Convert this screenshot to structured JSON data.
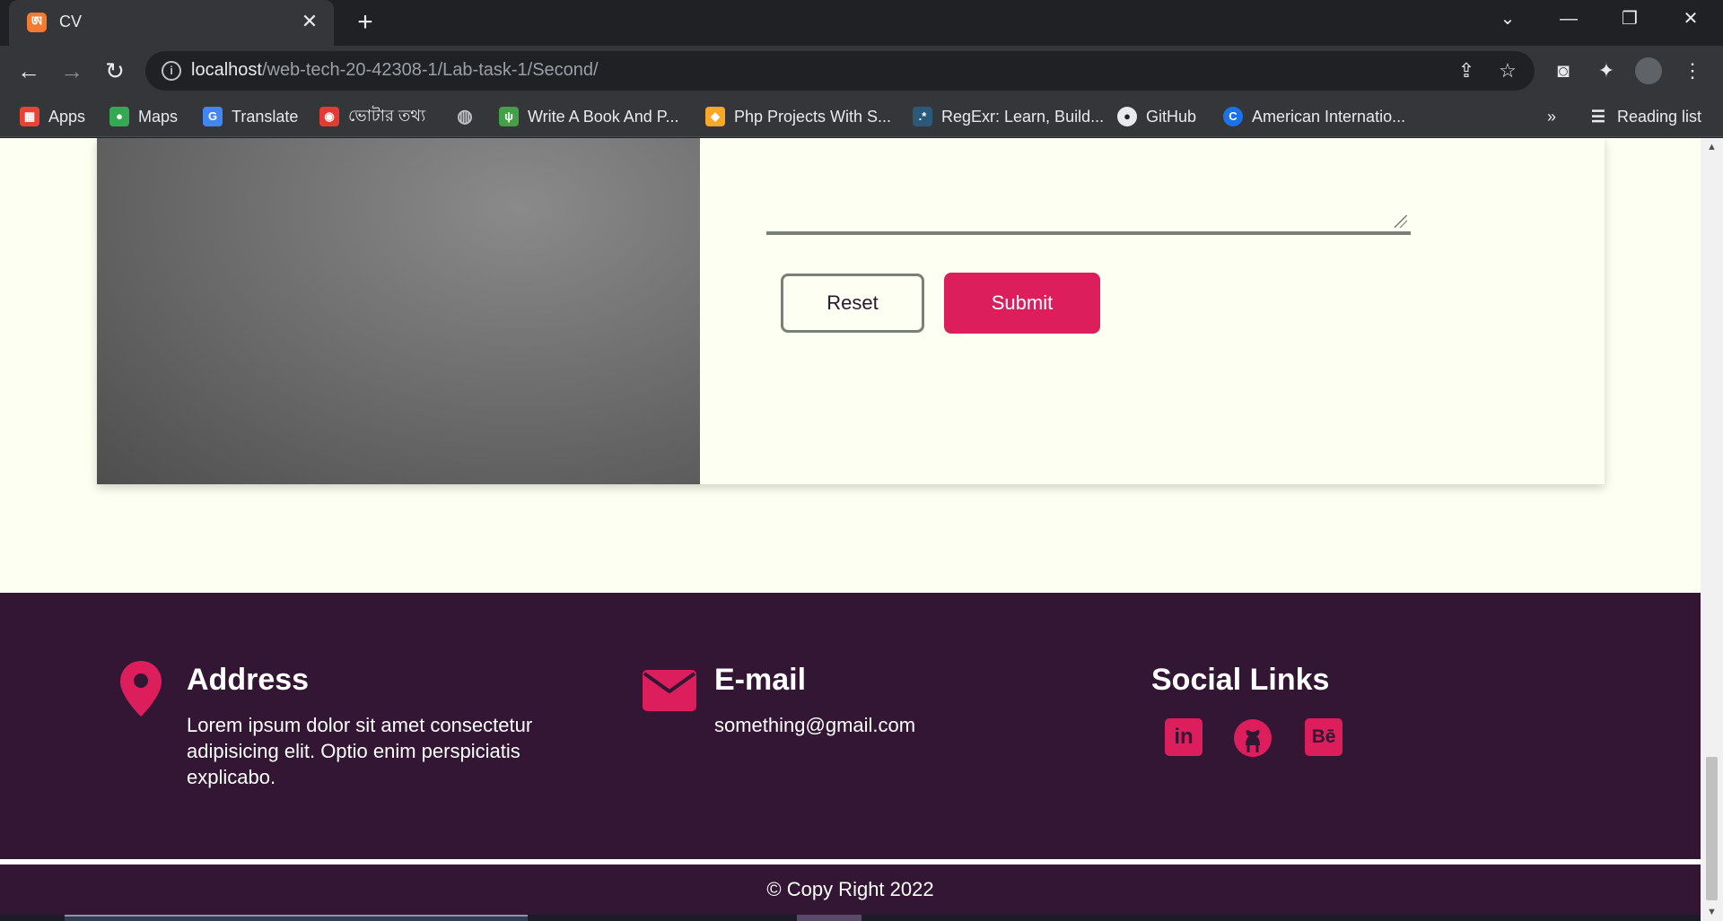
{
  "browser": {
    "tab": {
      "title": "CV",
      "favicon": "xampp-icon"
    },
    "address": {
      "host": "localhost",
      "path": "/web-tech-20-42308-1/Lab-task-1/Second/"
    },
    "bookmarks": [
      {
        "label": "Apps",
        "icon": "apps-grid-icon",
        "color": "#ea4335"
      },
      {
        "label": "Maps",
        "icon": "maps-pin-icon",
        "color": "#34a853"
      },
      {
        "label": "Translate",
        "icon": "translate-icon",
        "color": "#4285f4"
      },
      {
        "label": "ভোটার তথ্য",
        "icon": "voter-info-icon",
        "color": "#e53935"
      },
      {
        "label": "",
        "icon": "globe-icon",
        "color": "#bdc1c6"
      },
      {
        "label": "Write A Book And P...",
        "icon": "book-icon",
        "color": "#43a047"
      },
      {
        "label": "Php Projects With S...",
        "icon": "php-icon",
        "color": "#f9a825"
      },
      {
        "label": "RegExr: Learn, Build...",
        "icon": "regexr-icon",
        "color": "#2a5a7a"
      },
      {
        "label": "GitHub",
        "icon": "github-icon",
        "color": "#e8eaed"
      },
      {
        "label": "American Internatio...",
        "icon": "aiub-icon",
        "color": "#1a73e8"
      }
    ],
    "overflow": "»",
    "reading_list": "Reading list"
  },
  "form": {
    "reset_label": "Reset",
    "submit_label": "Submit"
  },
  "footer": {
    "address": {
      "title": "Address",
      "text": "Lorem ipsum dolor sit amet consectetur adipisicing elit. Optio enim perspiciatis explicabo."
    },
    "email": {
      "title": "E-mail",
      "text": "something@gmail.com"
    },
    "social": {
      "title": "Social Links",
      "links": [
        "linkedin-icon",
        "github-icon",
        "behance-icon"
      ]
    },
    "copyright": "© Copy Right 2022"
  },
  "colors": {
    "accent": "#dc1e5c",
    "footer_bg": "#321633",
    "page_bg": "#fdfff2"
  }
}
